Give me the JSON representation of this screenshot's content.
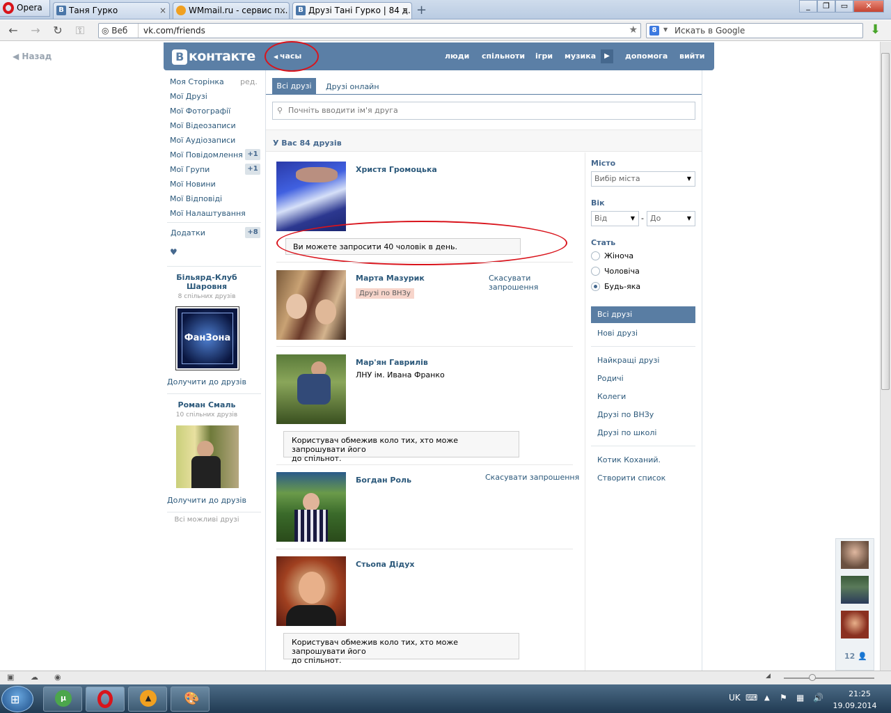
{
  "browser": {
    "opera_label": "Opera",
    "tabs": [
      {
        "label": "Таня Гурко",
        "icon": "vk-favicon"
      },
      {
        "label": "WMmail.ru - сервис п...",
        "icon": "wmmail-favicon"
      },
      {
        "label": "Друзі Тані Гурко | 84 д...",
        "icon": "vk-favicon"
      }
    ],
    "new_tab": "+",
    "address_prefix": "Веб",
    "url": "vk.com/friends",
    "search_placeholder": "Искать в Google",
    "search_engine_icon": "8"
  },
  "page": {
    "back_label": "Назад",
    "header": {
      "logo_letter": "В",
      "logo_text": "контакте",
      "status_link": "часы",
      "nav": [
        "люди",
        "спільноти",
        "ігри",
        "музика",
        "допомога",
        "вийти"
      ]
    },
    "left_menu": {
      "edit_label": "ред.",
      "items": [
        {
          "label": "Моя Сторінка"
        },
        {
          "label": "Мої Друзі"
        },
        {
          "label": "Мої Фотографії"
        },
        {
          "label": "Мої Відеозаписи"
        },
        {
          "label": "Мої Аудіозаписи"
        },
        {
          "label": "Мої Повідомлення",
          "count": "+1"
        },
        {
          "label": "Мої Групи",
          "count": "+1"
        },
        {
          "label": "Мої Новини"
        },
        {
          "label": "Мої Відповіді"
        },
        {
          "label": "Мої Налаштування"
        }
      ],
      "apps": {
        "label": "Додатки",
        "count": "+8"
      },
      "heart": "♥"
    },
    "suggestions": [
      {
        "name": "Більярд-Клуб Шаровня",
        "mutual": "8 спільних друзів",
        "add": "Долучити до друзів",
        "logo_text": "ФанЗона"
      },
      {
        "name": "Роман Смаль",
        "mutual": "10 спільних друзів",
        "add": "Долучити до друзів"
      }
    ],
    "all_possible": "Всі можливі друзі",
    "tabs": {
      "all": "Всі друзі",
      "online": "Друзі онлайн"
    },
    "search_placeholder": "Почніть вводити ім'я друга",
    "summary": "У Вас 84 друзів",
    "friends": [
      {
        "name": "Христя Громоцька",
        "notice": "Ви можете запросити 40 чоловік в день."
      },
      {
        "name": "Марта Мазурик",
        "tag": "Друзі по ВНЗу",
        "action_line1": "Скасувати",
        "action_line2": "запрошення"
      },
      {
        "name": "Мар'ян Гаврилів",
        "sub": "ЛНУ ім. Ивана Франко",
        "notice_line1": "Користувач обмежив коло тих, хто може запрошувати його",
        "notice_line2": "до спільнот."
      },
      {
        "name": "Богдан Роль",
        "action": "Скасувати запрошення"
      },
      {
        "name": "Стьопа Дідух",
        "notice_line1": "Користувач обмежив коло тих, хто може запрошувати його",
        "notice_line2": "до спільнот."
      }
    ],
    "filters": {
      "city_label": "Місто",
      "city_value": "Вибір міста",
      "age_label": "Вік",
      "age_from": "Від",
      "age_dash": "-",
      "age_to": "До",
      "sex_label": "Стать",
      "sex_options": [
        {
          "label": "Жіноча",
          "selected": false
        },
        {
          "label": "Чоловіча",
          "selected": false
        },
        {
          "label": "Будь-яка",
          "selected": true
        }
      ],
      "categories": [
        "Всі друзі",
        "Нові друзі",
        "Найкращі друзі",
        "Родичі",
        "Колеги",
        "Друзі по ВНЗу",
        "Друзі по школі",
        "Котик Коханий.",
        "Створити список"
      ]
    },
    "online_count": "12"
  },
  "taskbar": {
    "lang": "UK",
    "time": "21:25",
    "date": "19.09.2014"
  },
  "colors": {
    "vk_blue": "#5b7fa6",
    "link": "#2b587a",
    "annotation_red": "#d9141c"
  }
}
